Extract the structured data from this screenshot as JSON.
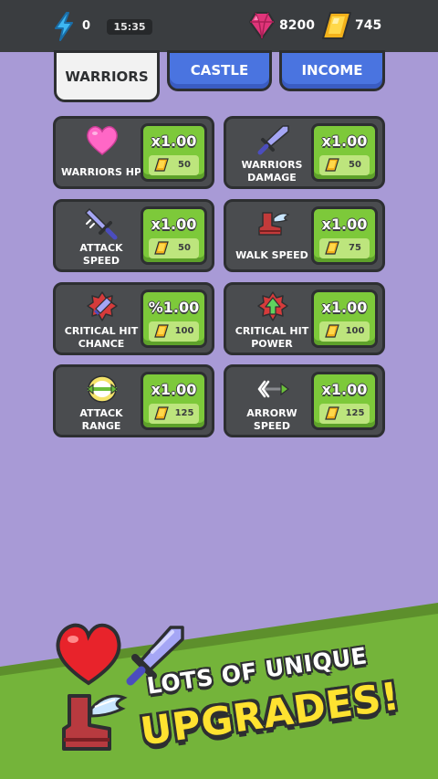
{
  "topbar": {
    "energy_count": "0",
    "timer": "15:35",
    "gems": "8200",
    "gold": "745"
  },
  "tabs": [
    {
      "label": "WARRIORS",
      "active": true
    },
    {
      "label": "CASTLE",
      "active": false
    },
    {
      "label": "INCOME",
      "active": false
    }
  ],
  "upgrades": [
    {
      "label": "WARRIORS HP",
      "multiplier": "x1.00",
      "cost": "50",
      "icon": "heart-icon"
    },
    {
      "label": "WARRIORS DAMAGE",
      "multiplier": "x1.00",
      "cost": "50",
      "icon": "sword-icon"
    },
    {
      "label": "ATTACK SPEED",
      "multiplier": "x1.00",
      "cost": "50",
      "icon": "fast-sword-icon"
    },
    {
      "label": "WALK SPEED",
      "multiplier": "x1.00",
      "cost": "75",
      "icon": "winged-boot-icon"
    },
    {
      "label": "CRITICAL HIT CHANCE",
      "multiplier": "%1.00",
      "cost": "100",
      "icon": "crit-chance-icon"
    },
    {
      "label": "CRITICAL HIT POWER",
      "multiplier": "x1.00",
      "cost": "100",
      "icon": "crit-power-icon"
    },
    {
      "label": "ATTACK RANGE",
      "multiplier": "x1.00",
      "cost": "125",
      "icon": "range-icon"
    },
    {
      "label": "ARRORW SPEED",
      "multiplier": "x1.00",
      "cost": "125",
      "icon": "arrow-speed-icon"
    }
  ],
  "promo": {
    "line1": "LOTS OF UNIQUE",
    "line2": "UPGRADES!"
  },
  "colors": {
    "background": "#a89ad6",
    "topbar": "#3a3d40",
    "tab_inactive": "#4a74e0",
    "button_green": "#7dc93a",
    "card": "#4a4c4f",
    "banner_green": "#74b43a",
    "promo_yellow": "#ffe230"
  }
}
